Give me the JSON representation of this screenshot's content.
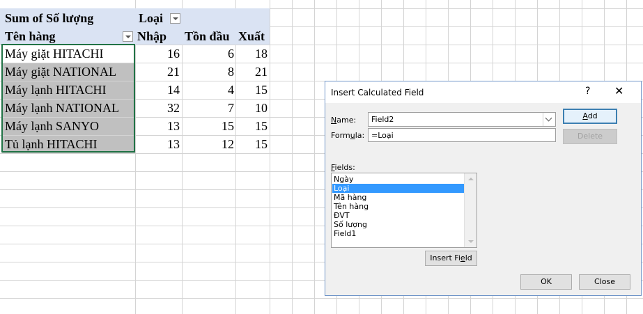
{
  "pivot": {
    "corner_label": "Sum of Số lượng",
    "col_field_label": "Loại",
    "row_field_label": "Tên hàng",
    "columns": [
      "Nhập",
      "Tồn đầu",
      "Xuất"
    ],
    "rows": [
      {
        "name": "Máy giặt HITACHI",
        "values": [
          "16",
          "6",
          "18"
        ]
      },
      {
        "name": "Máy giặt NATIONAL",
        "values": [
          "21",
          "8",
          "21"
        ]
      },
      {
        "name": "Máy lạnh HITACHI",
        "values": [
          "14",
          "4",
          "15"
        ]
      },
      {
        "name": "Máy lạnh NATIONAL",
        "values": [
          "32",
          "7",
          "10"
        ]
      },
      {
        "name": "Máy lạnh SANYO",
        "values": [
          "13",
          "15",
          "15"
        ]
      },
      {
        "name": "Tủ lạnh HITACHI",
        "values": [
          "13",
          "12",
          "15"
        ]
      }
    ]
  },
  "dialog": {
    "title": "Insert Calculated Field",
    "help_glyph": "?",
    "close_glyph": "✕",
    "name_label_pre": "N",
    "name_label_post": "ame:",
    "name_value": "Field2",
    "formula_label_pre": "Form",
    "formula_label_u": "u",
    "formula_label_post": "la:",
    "formula_value": "=Loại",
    "fields_label_pre": "F",
    "fields_label_post": "ields:",
    "fields": [
      "Ngày",
      "Loại",
      "Mã hàng",
      "Tên hàng",
      "ĐVT",
      "Số lượng",
      "Field1"
    ],
    "selected_field": "Loại",
    "add_label_pre": "",
    "add_label_u": "A",
    "add_label_post": "dd",
    "delete_label": "Delete",
    "insert_field_pre": "Insert Fi",
    "insert_field_u": "e",
    "insert_field_post": "ld",
    "ok_label": "OK",
    "close_label": "Close"
  }
}
